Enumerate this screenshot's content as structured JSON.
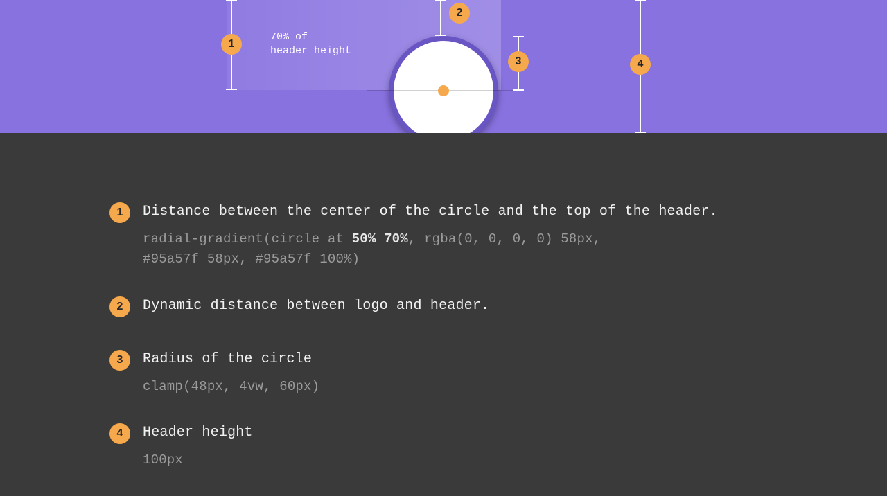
{
  "header": {
    "annotation_label_line1": "70% of",
    "annotation_label_line2": "header height",
    "markers": {
      "m1": "1",
      "m2": "2",
      "m3": "3",
      "m4": "4"
    }
  },
  "colors": {
    "header_bg": "#8872e0",
    "body_bg": "#3a3a3a",
    "accent": "#f5a84c",
    "gradient_ref": "#95a57f"
  },
  "legend": {
    "items": [
      {
        "num": "1",
        "title": "Distance between the center of the circle and the top of the header.",
        "code_pre": "radial-gradient(circle at ",
        "code_strong": "50% 70%",
        "code_post": ", rgba(0, 0, 0, 0) 58px,",
        "code_line2": "#95a57f 58px, #95a57f 100%)"
      },
      {
        "num": "2",
        "title": "Dynamic distance between logo and header.",
        "code_pre": "",
        "code_strong": "",
        "code_post": "",
        "code_line2": ""
      },
      {
        "num": "3",
        "title": "Radius of the circle",
        "code_pre": "",
        "code_strong": "",
        "code_post": "",
        "code_line2": "clamp(48px, 4vw, 60px)"
      },
      {
        "num": "4",
        "title": "Header height",
        "code_pre": "",
        "code_strong": "",
        "code_post": "",
        "code_line2": "100px"
      }
    ]
  }
}
